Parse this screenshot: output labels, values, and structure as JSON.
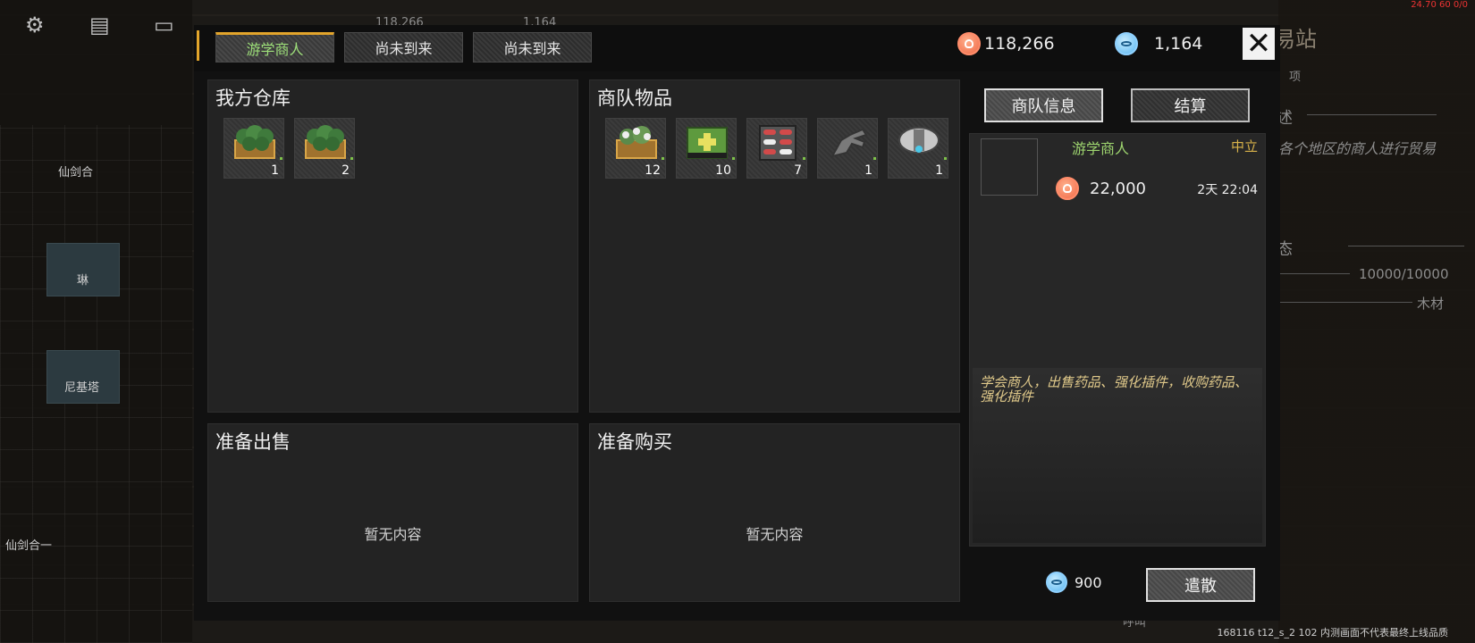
{
  "background": {
    "names": [
      "仙剑合",
      "琳",
      "尼基塔",
      "仙剑合一"
    ],
    "hidden_tab_text": [
      "118,266",
      "1,164"
    ],
    "building_title": "易站",
    "side_labels": [
      "项",
      "述",
      "各个地区的商人进行贸易",
      "态"
    ],
    "hp": "10000/10000",
    "material": "木材",
    "bottom_label": "呼叫",
    "debug": "24.70 60 0/0",
    "build_note": "168116 t12_s_2 102  内测画面不代表最终上线品质"
  },
  "tabs": [
    {
      "label": "游学商人",
      "active": true
    },
    {
      "label": "尚未到来",
      "active": false
    },
    {
      "label": "尚未到来",
      "active": false
    }
  ],
  "currency": {
    "silver": "118,266",
    "gem": "1,164"
  },
  "panels": {
    "warehouse": {
      "title": "我方仓库",
      "items": [
        {
          "icon": "herb-crate",
          "qty": "1"
        },
        {
          "icon": "herb-crate",
          "qty": "2"
        }
      ]
    },
    "caravan": {
      "title": "商队物品",
      "items": [
        {
          "icon": "flower-crate",
          "qty": "12"
        },
        {
          "icon": "medkit",
          "qty": "10"
        },
        {
          "icon": "pill-pack",
          "qty": "7"
        },
        {
          "icon": "mech-claw",
          "qty": "1"
        },
        {
          "icon": "drone-module",
          "qty": "1"
        }
      ]
    },
    "sell": {
      "title": "准备出售",
      "empty": "暂无内容"
    },
    "buy": {
      "title": "准备购买",
      "empty": "暂无内容"
    }
  },
  "info": {
    "tab_caravan": "商队信息",
    "tab_settle": "结算",
    "trader_name": "游学商人",
    "stance": "中立",
    "wealth": "22,000",
    "time_left": "2天 22:04",
    "description": "学会商人，出售药品、强化插件，收购药品、强化插件",
    "fee": "900",
    "dismiss": "遣散"
  },
  "colors": {
    "accent": "#e3a52b",
    "trader_green": "#9ed56f",
    "stance_gold": "#d9b34a"
  }
}
